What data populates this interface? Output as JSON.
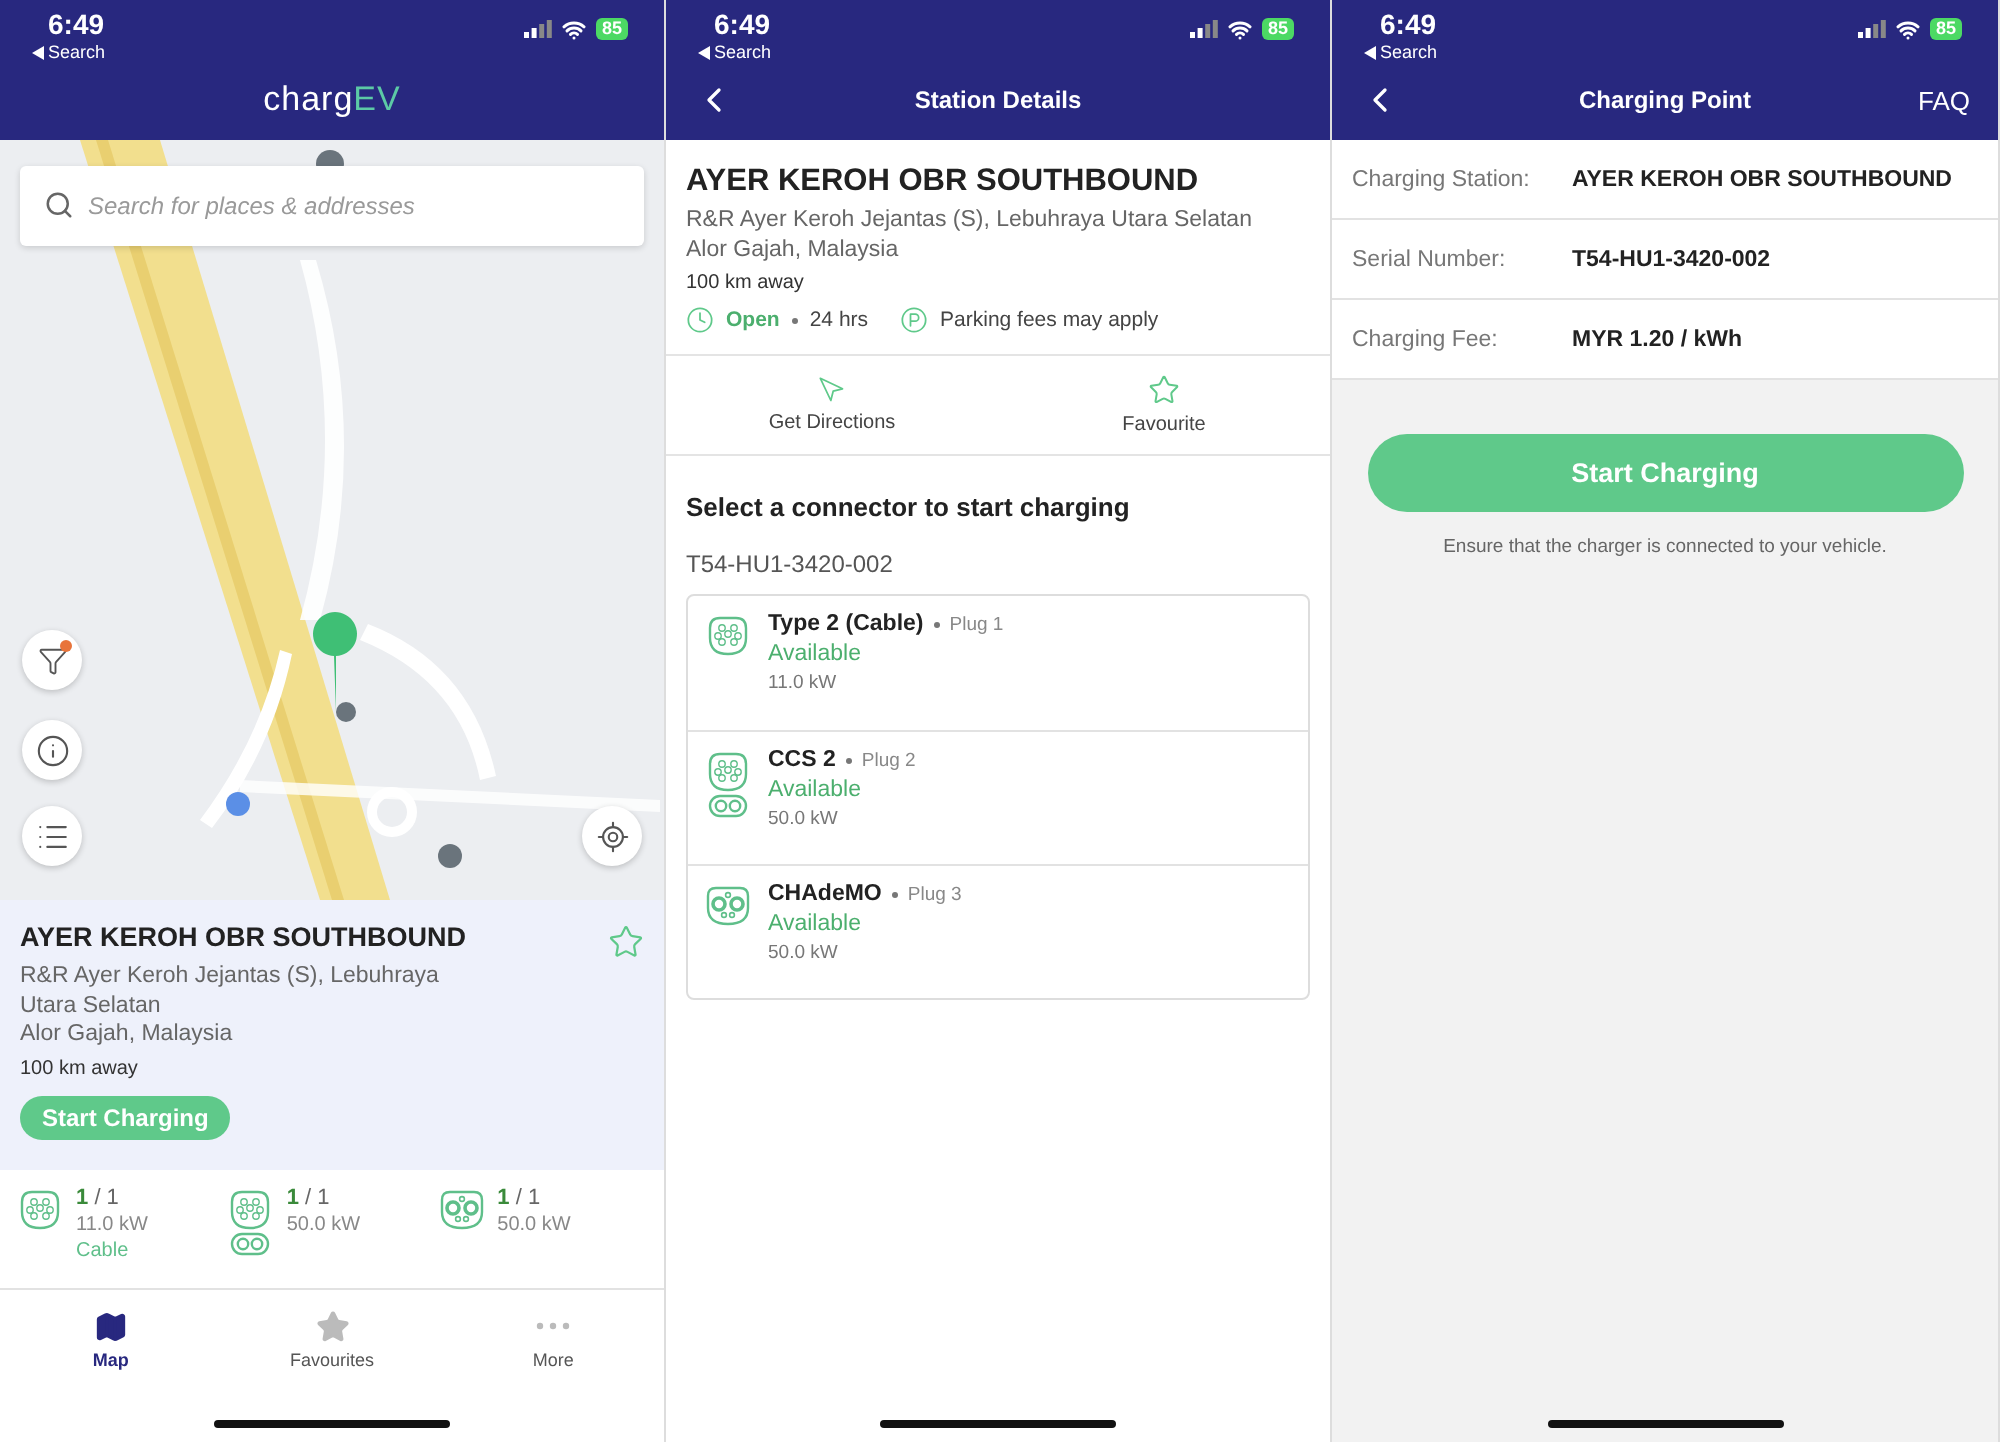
{
  "map_screen": {
    "status_bar": {
      "time": "6:49",
      "back_label": "Search",
      "battery": "85"
    },
    "logo": [
      {
        "text": "charg",
        "color": "#ffffff"
      },
      {
        "text": "EV",
        "color": "#5cc9a6"
      }
    ],
    "search": {
      "placeholder": "Search for places & addresses"
    },
    "filter_badge": true,
    "station": {
      "name": "AYER KEROH OBR SOUTHBOUND",
      "address": [
        "R&R Ayer Keroh Jejantas (S), Lebuhraya Utara Selatan",
        "Alor Gajah, Malaysia"
      ],
      "distance": "100 km away",
      "favourite": false,
      "action": "Start Charging"
    },
    "connectors": [
      {
        "kind": "type2",
        "available": "1",
        "total": "/ 1",
        "power": "11.0 kW",
        "note": "Cable"
      },
      {
        "kind": "ccs2",
        "available": "1",
        "total": "/ 1",
        "power": "50.0 kW"
      },
      {
        "kind": "chademo",
        "available": "1",
        "total": "/ 1",
        "power": "50.0 kW"
      }
    ],
    "tabs": [
      {
        "kind": "map",
        "label": "Map",
        "selected": true
      },
      {
        "kind": "star",
        "label": "Favourites",
        "selected": false
      },
      {
        "kind": "more",
        "label": "More",
        "selected": false
      }
    ]
  },
  "station_details": {
    "status_bar": {
      "time": "6:49",
      "back_label": "Search",
      "battery": "85"
    },
    "title": "Station Details",
    "station": {
      "name": "AYER KEROH OBR SOUTHBOUND",
      "address": [
        "R&R Ayer Keroh Jejantas (S), Lebuhraya Utara Selatan",
        "Alor Gajah, Malaysia"
      ],
      "distance": "100 km away",
      "status": "Open",
      "hours": "24 hrs",
      "parking": "Parking fees may apply"
    },
    "actions": [
      {
        "kind": "directions",
        "label": "Get Directions"
      },
      {
        "kind": "favourite",
        "label": "Favourite"
      }
    ],
    "prompt": "Select a connector to start charging",
    "serial": "T54-HU1-3420-002",
    "connectors": [
      {
        "kind": "type2",
        "name": "Type 2 (Cable)",
        "plug": "Plug 1",
        "status": "Available",
        "power": "11.0 kW"
      },
      {
        "kind": "ccs2",
        "name": "CCS 2",
        "plug": "Plug 2",
        "status": "Available",
        "power": "50.0 kW"
      },
      {
        "kind": "chademo",
        "name": "CHAdeMO",
        "plug": "Plug 3",
        "status": "Available",
        "power": "50.0 kW"
      }
    ]
  },
  "charging_point": {
    "status_bar": {
      "time": "6:49",
      "back_label": "Search",
      "battery": "85"
    },
    "title": "Charging Point",
    "action": "FAQ",
    "details": [
      {
        "label": "Charging Station:",
        "value": "AYER KEROH OBR SOUTHBOUND"
      },
      {
        "label": "Serial Number:",
        "value": "T54-HU1-3420-002"
      },
      {
        "label": "Charging Fee:",
        "value": "MYR 1.20 / kWh"
      }
    ],
    "button": "Start Charging",
    "note": "Ensure that the charger is connected to your vehicle."
  }
}
